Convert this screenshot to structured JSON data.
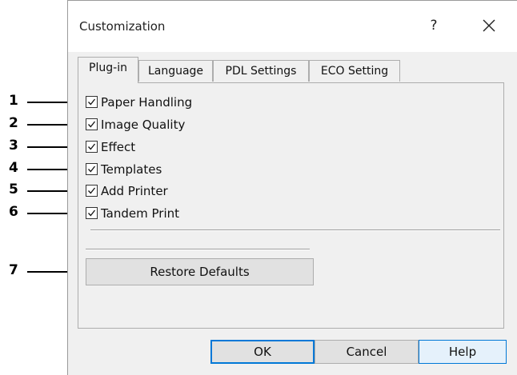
{
  "dialog": {
    "title": "Customization",
    "help_glyph": "?",
    "close_icon": "close-icon"
  },
  "tabs": [
    {
      "label": "Plug-in",
      "active": true
    },
    {
      "label": "Language",
      "active": false
    },
    {
      "label": "PDL Settings",
      "active": false
    },
    {
      "label": "ECO Setting",
      "active": false
    }
  ],
  "plugins": [
    {
      "label": "Paper Handling",
      "checked": true
    },
    {
      "label": "Image Quality",
      "checked": true
    },
    {
      "label": "Effect",
      "checked": true
    },
    {
      "label": "Templates",
      "checked": true
    },
    {
      "label": "Add Printer",
      "checked": true
    },
    {
      "label": "Tandem Print",
      "checked": true
    }
  ],
  "restore_defaults_label": "Restore Defaults",
  "buttons": {
    "ok": "OK",
    "cancel": "Cancel",
    "help": "Help"
  },
  "callouts": [
    "1",
    "2",
    "3",
    "4",
    "5",
    "6",
    "7"
  ],
  "colors": {
    "accent": "#0078d7",
    "dialog_bg": "#f0f0f0",
    "button_bg": "#e1e1e1"
  }
}
